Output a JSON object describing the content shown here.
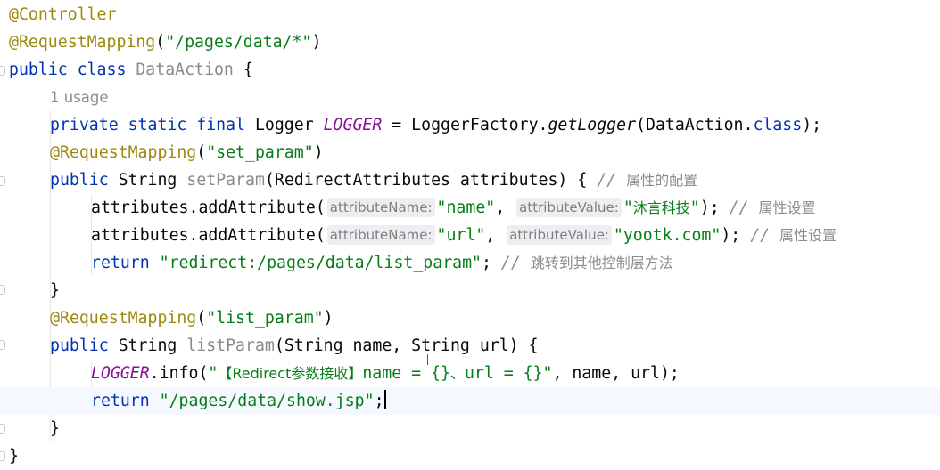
{
  "editor": {
    "lines": [
      {
        "annotation": "@Controller"
      },
      {
        "annotation": "@RequestMapping",
        "open": "(",
        "path": "\"/pages/data/*\"",
        "close": ")"
      },
      {
        "kw_public": "public",
        "kw_class": "class",
        "class_name": "DataAction",
        "brace": "{"
      },
      {
        "usage_hint": "1 usage"
      },
      {
        "modifiers": "private static final",
        "type": "Logger",
        "const": "LOGGER",
        "assign": "=",
        "factory": "LoggerFactory.",
        "method": "getLogger",
        "arg_open": "(DataAction.",
        "class_kw": "class",
        "end": ");"
      },
      {
        "annotation": "@RequestMapping",
        "open": "(",
        "value": "\"set_param\"",
        "close": ")"
      },
      {
        "kw": "public",
        "type": "String",
        "name": "setParam",
        "params": "(RedirectAttributes attributes) {",
        "comment": "//",
        "comment_text": "属性的配置"
      },
      {
        "call": "attributes.addAttribute(",
        "hint1": "attributeName:",
        "arg1": "\"name\"",
        "sep": ",",
        "hint2": "attributeValue:",
        "q_open": "\"",
        "arg2_text": "沐言科技",
        "q_close": "\"",
        "end": ");",
        "comment": "//",
        "comment_text": "属性设置"
      },
      {
        "call": "attributes.addAttribute(",
        "hint1": "attributeName:",
        "arg1": "\"url\"",
        "sep": ",",
        "hint2": "attributeValue:",
        "arg2": "\"yootk.com\"",
        "end": ");",
        "comment": "//",
        "comment_text": "属性设置"
      },
      {
        "kw": "return",
        "value": "\"redirect:/pages/data/list_param\"",
        "end": ";",
        "comment": "//",
        "comment_text": "跳转到其他控制层方法"
      },
      {
        "brace": "}"
      },
      {
        "annotation": "@RequestMapping",
        "open": "(",
        "value": "\"list_param\"",
        "close": ")"
      },
      {
        "kw": "public",
        "type": "String",
        "name": "listParam",
        "params": "(String name, String url) {"
      },
      {
        "const": "LOGGER",
        "call": ".info(",
        "q_open": "\"",
        "cn1": "【Redirect参数接收】",
        "mid": "name = {}",
        "cn2": "、",
        "mid2": "url = {}",
        "q_close": "\"",
        "args": ", name, url);"
      },
      {
        "kw": "return",
        "value": "\"/pages/data/show.jsp\"",
        "end": ";"
      },
      {
        "brace": "}"
      },
      {
        "brace": "}"
      }
    ]
  }
}
